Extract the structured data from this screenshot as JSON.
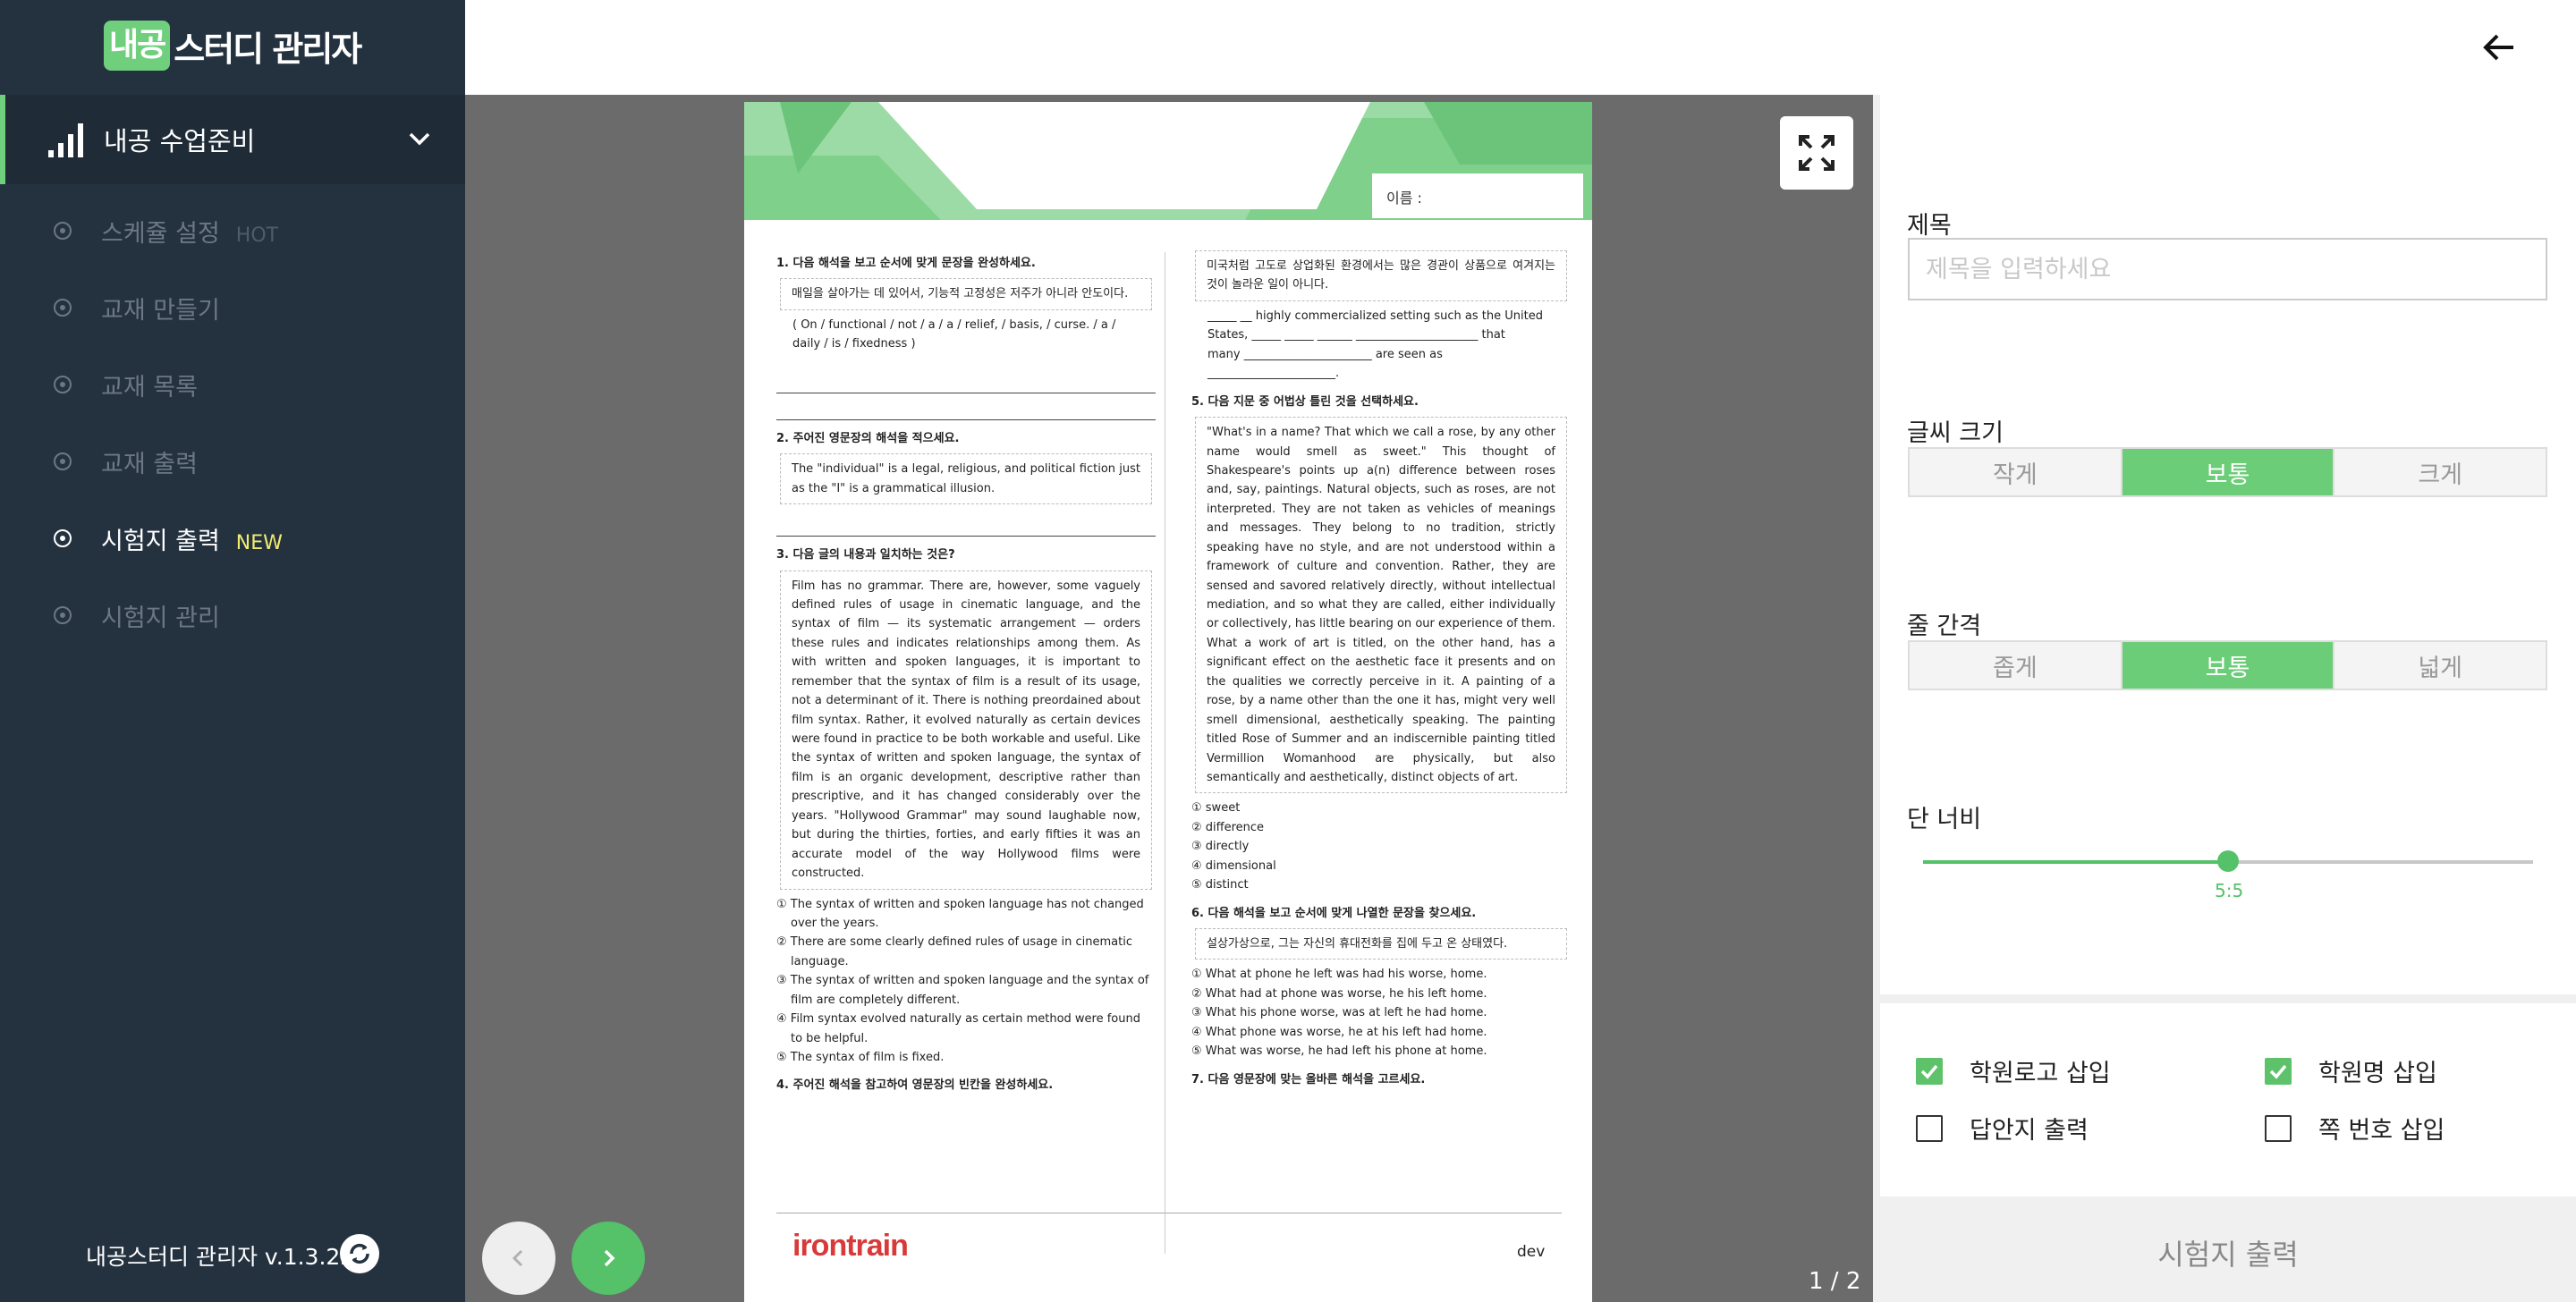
{
  "sidebar": {
    "logo_badge": "내공",
    "logo_text": "스터디 관리자",
    "main_menu": {
      "label": "내공 수업준비",
      "icon": "signal-bars-icon"
    },
    "items": [
      {
        "label": "스케쥴 설정",
        "badge": "HOT"
      },
      {
        "label": "교재 만들기",
        "badge": ""
      },
      {
        "label": "교재 목록",
        "badge": ""
      },
      {
        "label": "교재 출력",
        "badge": ""
      },
      {
        "label": "시험지 출력",
        "badge": "NEW",
        "active": true
      },
      {
        "label": "시험지 관리",
        "badge": ""
      }
    ],
    "version": "내공스터디 관리자 v.1.3.22"
  },
  "viewer": {
    "page_indicator": "1 / 2",
    "paper": {
      "name_label": "이름 :",
      "left": {
        "q1": "1. 다음 해석을 보고 순서에 맞게 문장을 완성하세요.",
        "q1_box": "매일을 살아가는 데 있어서, 기능적 고정성은 저주가 아니라 안도이다.",
        "q1_words": "( On / functional / not / a / a / relief, / basis, / curse. / a / daily / is / fixedness )",
        "q2": "2. 주어진 영문장의 해석을 적으세요.",
        "q2_box": "The \"individual\" is a legal, religious, and political fiction just as the \"I\" is a grammatical illusion.",
        "q3": "3. 다음 글의 내용과 일치하는 것은?",
        "q3_box": "Film has no grammar. There are, however, some vaguely defined rules of usage in cinematic language, and the syntax of film — its systematic arrangement — orders these rules and indicates relationships among them. As with written and spoken languages, it is important to remember that the syntax of film is a result of its usage, not a determinant of it. There is nothing preordained about film syntax. Rather, it evolved naturally as certain devices were found in practice to be both workable and useful. Like the syntax of written and spoken language, the syntax of film is an organic development, descriptive rather than prescriptive, and it has changed considerably over the years. \"Hollywood Grammar\" may sound laughable now, but during the thirties, forties, and early fifties it was an accurate model of the way Hollywood films were constructed.",
        "q3_opts": [
          "① The syntax of written and spoken language has not changed over the years.",
          "② There are some clearly defined rules of usage in cinematic language.",
          "③ The syntax of written and spoken language and the syntax of film are completely different.",
          "④ Film syntax evolved naturally as certain method were found to be helpful.",
          "⑤ The syntax of film is fixed."
        ],
        "q4": "4. 주어진 해석을 참고하여 영문장의 빈칸을 완성하세요."
      },
      "right": {
        "q4_box": "미국처럼 고도로 상업화된 환경에서는 많은 경관이 상품으로 여겨지는 것이 놀라운 일이 아니다.",
        "q4_blanks": [
          "_____ __ highly commercialized setting such as the United",
          "States, _____ _____ ______ _____________________ that",
          "many ______________________ are seen as",
          "______________________."
        ],
        "q5": "5. 다음 지문 중 어법상 틀린 것을 선택하세요.",
        "q5_box": "\"What's in a name? That which we call a rose, by any other name would smell as sweet.\" This thought of Shakespeare's points up a(n) difference between roses and, say, paintings. Natural objects, such as roses, are not interpreted. They are not taken as vehicles of meanings and messages. They belong to no tradition, strictly speaking have no style, and are not understood within a framework of culture and convention. Rather, they are sensed and savored relatively directly, without intellectual mediation, and so what they are called, either individually or collectively, has little bearing on our experience of them. What a work of art is titled, on the other hand, has a significant effect on the aesthetic face it presents and on the qualities we correctly perceive in it. A painting of a rose, by a name other than the one it has, might very well smell dimensional, aesthetically speaking. The painting titled Rose of Summer and an indiscernible painting titled Vermillion Womanhood are physically, but also semantically and aesthetically, distinct objects of art.",
        "q5_opts": [
          "① sweet",
          "② difference",
          "③ directly",
          "④ dimensional",
          "⑤ distinct"
        ],
        "q6": "6. 다음 해석을 보고 순서에 맞게 나열한 문장을 찾으세요.",
        "q6_box": "설상가상으로, 그는 자신의 휴대전화를 집에 두고 온 상태였다.",
        "q6_opts": [
          "① What at phone he left was had his worse, home.",
          "② What had at phone was worse, he his left home.",
          "③ What his phone worse, was at left he had home.",
          "④ What phone was worse, he at his left had home.",
          "⑤ What was worse, he had left his phone at home."
        ],
        "q7": "7. 다음 영문장에 맞는 올바른 해석을 고르세요."
      },
      "brand": "irontrain",
      "footer_code": "dev"
    }
  },
  "panel": {
    "title_label": "제목",
    "title_placeholder": "제목을 입력하세요",
    "font_size_label": "글씨 크기",
    "font_size_options": [
      "작게",
      "보통",
      "크게"
    ],
    "line_spacing_label": "줄 간격",
    "line_spacing_options": [
      "좁게",
      "보통",
      "넓게"
    ],
    "column_width_label": "단 너비",
    "column_width_value": "5:5",
    "column_width_fraction": 0.5,
    "checkboxes": [
      {
        "label": "학원로고 삽입",
        "checked": true
      },
      {
        "label": "학원명 삽입",
        "checked": true
      },
      {
        "label": "답안지 출력",
        "checked": false
      },
      {
        "label": "쪽 번호 삽입",
        "checked": false
      }
    ],
    "print_button": "시험지 출력"
  },
  "colors": {
    "accent": "#55c169",
    "sidebar": "#243240",
    "new_badge": "#f2ec6f"
  }
}
